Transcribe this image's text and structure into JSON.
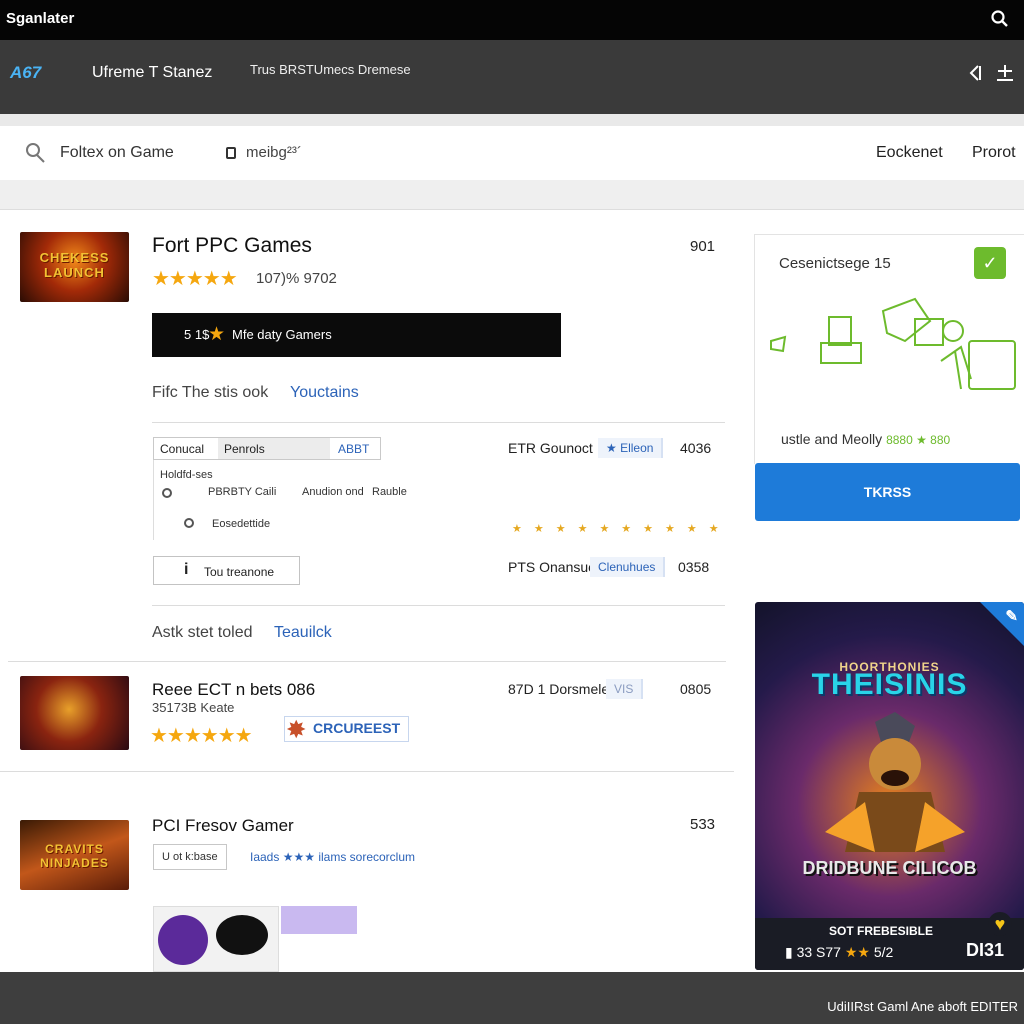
{
  "app": {
    "title": "Sganlater"
  },
  "header": {
    "logo": "A67",
    "store_name": "Ufreme T Stanez",
    "tagline": "Trus BRSTUmecs Dremese"
  },
  "searchbar": {
    "query": "Foltex on Game",
    "filter": "meibg²³´",
    "nav": [
      "Eockenet",
      "Prorot"
    ]
  },
  "games": [
    {
      "title": "Fort PPC Games",
      "rating_text": "107)% 9702",
      "price": "901",
      "action_label": "5 1$",
      "action_text": "Mfe daty Gamers",
      "sub_label": "Fifc The stis ook",
      "sub_link": "Youctains",
      "thumb_text": "CHEKESS LAUNCH",
      "tabs": [
        "Conucal",
        "Penrols",
        "ABBT"
      ],
      "detail_header": "Holdfd-ses",
      "details": [
        {
          "left": "PBRBTY Caili",
          "right_a": "Anudion ond",
          "right_b": "Rauble"
        },
        {
          "left": "Eosedettide"
        }
      ],
      "info_button": "Tou treanone",
      "meta_rows": [
        {
          "label": "ETR Gounoct",
          "link": "Elleon",
          "value": "4036"
        },
        {
          "label": "PTS Onansuct",
          "link": "Clenuhues",
          "value": "0358"
        }
      ],
      "footer_label": "Astk stet toled",
      "footer_link": "Teauilck"
    },
    {
      "title": "Reee ECT n bets 086",
      "subtitle": "35173B Keate",
      "cta": "CRCUREEST",
      "meta_label": "87D 1 Dorsmelese",
      "meta_tag": "VIS",
      "price": "0805"
    },
    {
      "title": "PCI Fresov Gamer",
      "price": "533",
      "tag": "U ot k:base",
      "info_a": "Iaads",
      "info_b": "ilams sorecorclum",
      "thumb_text": "CRAVITS NINJADES"
    }
  ],
  "side_panel": {
    "title": "Cesenictsege 15",
    "footer": "ustle and Meolly",
    "footer_code": "8880 ★ 880"
  },
  "primary_button": {
    "label": "TKRSS"
  },
  "featured": {
    "top_text": "HOORTHONIES",
    "title": "THEISINIS",
    "sub": "DRIDBUNE CILICOB",
    "footer_line1": "SOT FREBESIBLE",
    "footer_line2": "33 S77",
    "footer_stars": "★★",
    "footer_code": "5/2",
    "price": "DI31"
  },
  "bottom_bar": {
    "text": "UdiIIRst Gaml Ane aboft EDITER"
  },
  "colors": {
    "accent_blue": "#1e7bd9",
    "star_orange": "#f5a70f",
    "check_green": "#6dbb2d",
    "header_dark": "#3a3a3a"
  }
}
